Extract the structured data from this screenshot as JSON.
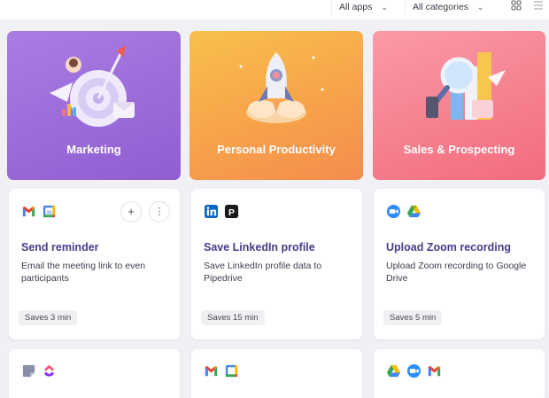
{
  "filters": {
    "apps_label": "All apps",
    "categories_label": "All categories"
  },
  "view_toggle": {
    "grid_icon": "grid-view-icon",
    "list_icon": "list-view-icon"
  },
  "categories": [
    {
      "label": "Marketing",
      "color": "#9a6ad8",
      "icon": "target-arrow-illustration"
    },
    {
      "label": "Personal Productivity",
      "color": "#f7a34a",
      "icon": "rocket-illustration"
    },
    {
      "label": "Sales & Prospecting",
      "color": "#f57e8d",
      "icon": "magnifier-chart-illustration"
    }
  ],
  "cards": [
    {
      "apps": [
        "gmail-icon",
        "google-calendar-icon"
      ],
      "title": "Send reminder",
      "description": "Email the meeting link to even participants",
      "saves": "Saves 3 min",
      "actions": [
        "add-icon",
        "more-icon"
      ]
    },
    {
      "apps": [
        "linkedin-icon",
        "pipedrive-icon"
      ],
      "title": "Save LinkedIn profile",
      "description": "Save LinkedIn profile data to Pipedrive",
      "saves": "Saves 15 min"
    },
    {
      "apps": [
        "zoom-icon",
        "google-drive-icon"
      ],
      "title": "Upload Zoom recording",
      "description": "Upload Zoom recording to Google Drive",
      "saves": "Saves 5 min"
    }
  ],
  "partial_cards": [
    {
      "apps": [
        "sticky-note-icon",
        "clickup-icon"
      ]
    },
    {
      "apps": [
        "gmail-icon",
        "google-calendar-icon"
      ]
    },
    {
      "apps": [
        "google-drive-icon",
        "zoom-icon",
        "gmail-icon"
      ]
    }
  ],
  "colors": {
    "title_text": "#4b3b8c",
    "page_background": "#f1f1f5"
  }
}
